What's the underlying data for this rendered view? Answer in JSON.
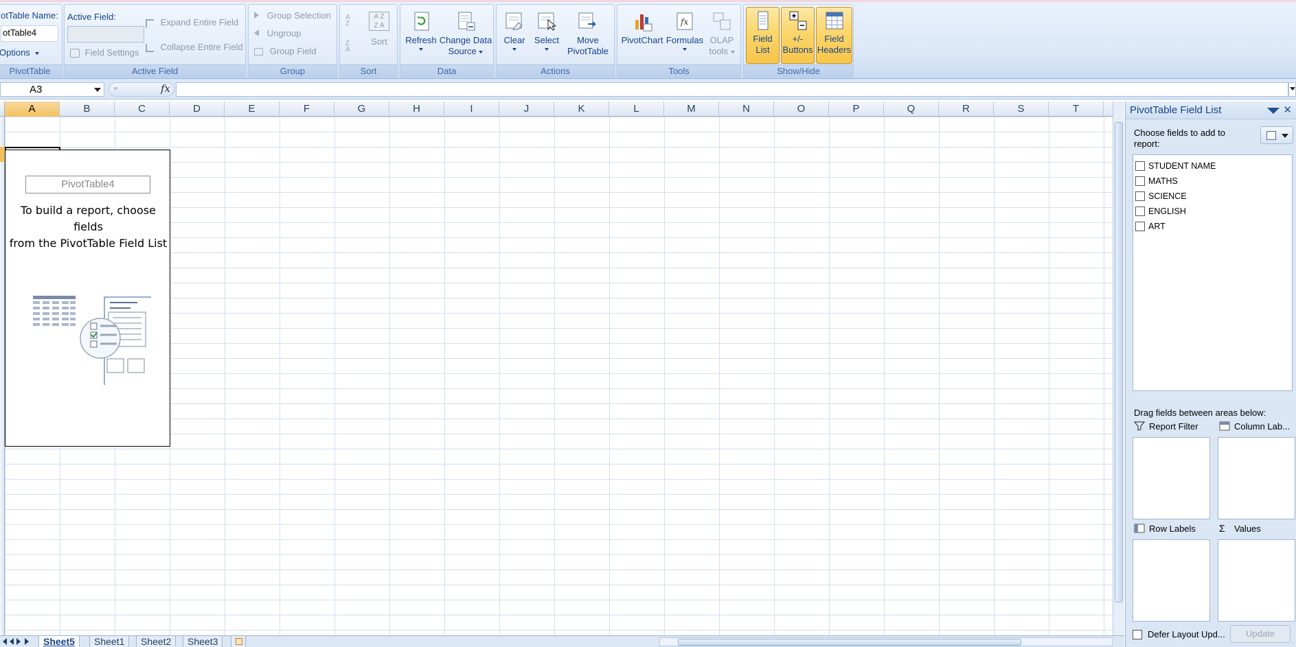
{
  "ribbon": {
    "pivottable": {
      "name_label": "otTable Name:",
      "name_value": "otTable4",
      "options_label": "Options",
      "group_label": "PivotTable"
    },
    "active_field": {
      "label": "Active Field:",
      "value": "",
      "field_settings": "Field Settings",
      "expand": "Expand Entire Field",
      "collapse": "Collapse Entire Field",
      "group_label": "Active Field"
    },
    "group": {
      "group_selection": "Group Selection",
      "ungroup": "Ungroup",
      "group_field": "Group Field",
      "group_label": "Group"
    },
    "sort": {
      "sort_label": "Sort",
      "group_label": "Sort"
    },
    "data": {
      "refresh": "Refresh",
      "change_source_1": "Change Data",
      "change_source_2": "Source",
      "group_label": "Data"
    },
    "actions": {
      "clear": "Clear",
      "select": "Select",
      "move_1": "Move",
      "move_2": "PivotTable",
      "group_label": "Actions"
    },
    "tools": {
      "pivotchart": "PivotChart",
      "formulas": "Formulas",
      "olap_1": "OLAP",
      "olap_2": "tools",
      "group_label": "Tools"
    },
    "showhide": {
      "field_list_1": "Field",
      "field_list_2": "List",
      "buttons_1": "+/-",
      "buttons_2": "Buttons",
      "headers_1": "Field",
      "headers_2": "Headers",
      "group_label": "Show/Hide"
    }
  },
  "formula_bar": {
    "name_box": "A3",
    "fx": "fx",
    "formula": ""
  },
  "sheet": {
    "columns": [
      "A",
      "B",
      "C",
      "D",
      "E",
      "F",
      "G",
      "H",
      "I",
      "J",
      "K",
      "L",
      "M",
      "N",
      "O",
      "P",
      "Q",
      "R",
      "S",
      "T"
    ],
    "pivot_placeholder": {
      "title": "PivotTable4",
      "message_line1": "To build a report, choose fields",
      "message_line2": "from the PivotTable Field List"
    },
    "tabs": [
      "Sheet5",
      "Sheet1",
      "Sheet2",
      "Sheet3"
    ],
    "active_tab": "Sheet5"
  },
  "field_list": {
    "title": "PivotTable Field List",
    "choose_text": "Choose fields to add to report:",
    "fields": [
      "STUDENT NAME",
      "MATHS",
      "SCIENCE",
      "ENGLISH",
      "ART"
    ],
    "drag_text": "Drag fields between areas below:",
    "areas": {
      "report_filter": "Report Filter",
      "column_labels": "Column Lab...",
      "row_labels": "Row Labels",
      "values": "Values"
    },
    "defer_label": "Defer Layout Upd...",
    "update_button": "Update"
  },
  "colors": {
    "ribbon_bg": "#dbe7f7",
    "ribbon_text": "#15428b",
    "toggle_active": "#fbd66b",
    "selected_header": "#f1c15f",
    "gridline": "#d4dfee"
  }
}
